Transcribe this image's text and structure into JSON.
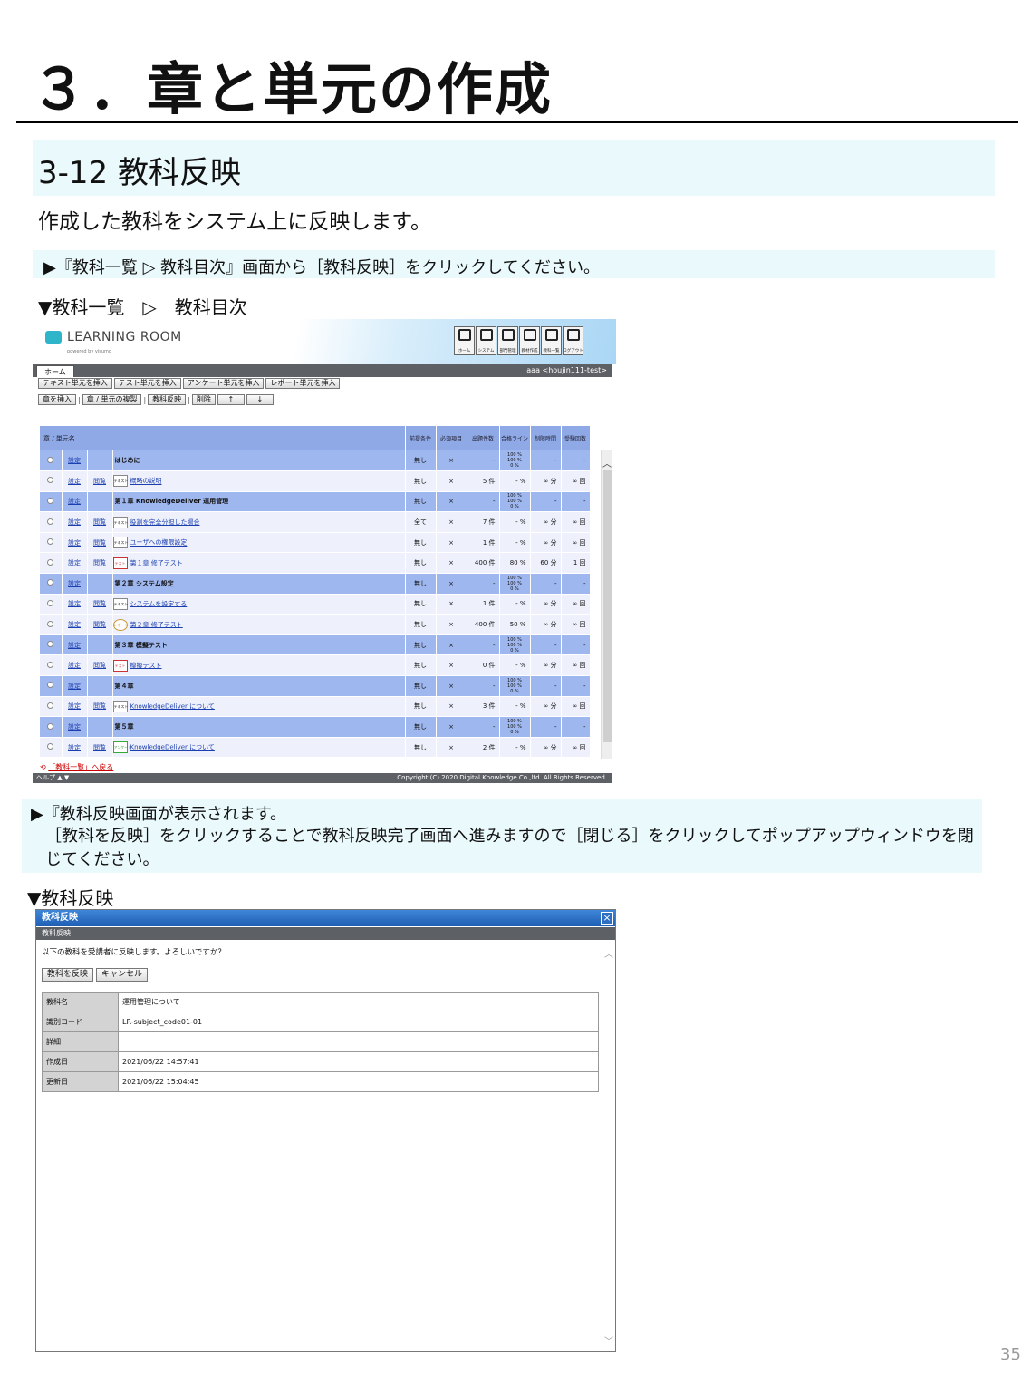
{
  "page": {
    "title": "３．章と単元の作成",
    "section_title": "3-12  教科反映",
    "intro": "作成した教科をシステム上に反映します。",
    "step1": "▶『教科一覧 ▷ 教科目次』画面から［教科反映］をクリックしてください。",
    "caption1": "▼教科一覧　▷　教科目次",
    "step2_line1": "▶『教科反映画面が表示されます。",
    "step2_line2": "［教科を反映］をクリックすることで教科反映完了画面へ進みますので［閉じる］をクリックしてポップアップウィンドウを閉じてください。",
    "caption2": "▼教科反映",
    "page_number": "35"
  },
  "shot1": {
    "logo_text": "LEARNING ROOM",
    "logo_sub": "powered by visumo",
    "toolbar": [
      {
        "label": "ホーム",
        "icon": "home-icon"
      },
      {
        "label": "システム",
        "icon": "system-icon"
      },
      {
        "label": "部門管理",
        "icon": "department-icon"
      },
      {
        "label": "教材作成",
        "icon": "material-icon"
      },
      {
        "label": "教科一覧",
        "icon": "subject-list-icon"
      },
      {
        "label": "ログアウト",
        "icon": "logout-icon"
      }
    ],
    "home_tab": "ホーム",
    "user": "aaa <houjin111-test>",
    "row1_buttons": [
      "テキスト単元を挿入",
      "テスト単元を挿入",
      "アンケート単元を挿入",
      "レポート単元を挿入"
    ],
    "row2_buttons": [
      "章を挿入",
      "章 / 単元の複製",
      "教科反映",
      "削除",
      "↑",
      "↓"
    ],
    "headers": {
      "name": "章 / 単元名",
      "h1": "前提条件",
      "h2": "必須項目",
      "h3": "出題件数",
      "h4": "合格ライン",
      "h5": "制限時間",
      "h6": "受験回数"
    },
    "setting_label": "設定",
    "view_label": "閲覧",
    "rows": [
      {
        "kind": "chap",
        "name": "はじめに",
        "c1": "無し",
        "c2": "×",
        "c3": "-",
        "c4": "100 %|100 %|0 %",
        "c5": "-",
        "c6": "-"
      },
      {
        "kind": "unit",
        "icon": "テキスト",
        "name": "概略の説明",
        "c1": "無し",
        "c2": "×",
        "c3": "5 件",
        "c4": "- %",
        "c5": "∞ 分",
        "c6": "∞ 回"
      },
      {
        "kind": "chap",
        "name": "第１章 KnowledgeDeliver 運用管理",
        "c1": "無し",
        "c2": "×",
        "c3": "-",
        "c4": "100 %|100 %|0 %",
        "c5": "-",
        "c6": "-"
      },
      {
        "kind": "unit",
        "icon": "テキスト",
        "name": "役割を完全分担した場合",
        "c1": "全て",
        "c2": "×",
        "c3": "7 件",
        "c4": "- %",
        "c5": "∞ 分",
        "c6": "∞ 回"
      },
      {
        "kind": "unit",
        "icon": "テキスト",
        "name": "ユーザへの権限設定",
        "c1": "無し",
        "c2": "×",
        "c3": "1 件",
        "c4": "- %",
        "c5": "∞ 分",
        "c6": "∞ 回"
      },
      {
        "kind": "unit",
        "icon": "テスト",
        "name": "第１章 修了テスト",
        "c1": "無し",
        "c2": "×",
        "c3": "400 件",
        "c4": "80 %",
        "c5": "60 分",
        "c6": "1 回"
      },
      {
        "kind": "chap",
        "name": "第２章 システム設定",
        "c1": "無し",
        "c2": "×",
        "c3": "-",
        "c4": "100 %|100 %|0 %",
        "c5": "-",
        "c6": "-"
      },
      {
        "kind": "unit",
        "icon": "テキスト",
        "name": "システムを設定する",
        "c1": "無し",
        "c2": "×",
        "c3": "1 件",
        "c4": "- %",
        "c5": "∞ 分",
        "c6": "∞ 回"
      },
      {
        "kind": "unit",
        "icon": "レポート",
        "name": "第２章 修了テスト",
        "c1": "無し",
        "c2": "×",
        "c3": "400 件",
        "c4": "50 %",
        "c5": "∞ 分",
        "c6": "∞ 回"
      },
      {
        "kind": "chap",
        "name": "第３章 模擬テスト",
        "c1": "無し",
        "c2": "×",
        "c3": "-",
        "c4": "100 %|100 %|0 %",
        "c5": "-",
        "c6": "-"
      },
      {
        "kind": "unit",
        "icon": "テスト",
        "name": "模擬テスト",
        "c1": "無し",
        "c2": "×",
        "c3": "0 件",
        "c4": "- %",
        "c5": "∞ 分",
        "c6": "∞ 回"
      },
      {
        "kind": "chap",
        "name": "第４章",
        "c1": "無し",
        "c2": "×",
        "c3": "-",
        "c4": "100 %|100 %|0 %",
        "c5": "-",
        "c6": "-"
      },
      {
        "kind": "unit",
        "icon": "テキスト",
        "name": "KnowledgeDeliver について",
        "c1": "無し",
        "c2": "×",
        "c3": "3 件",
        "c4": "- %",
        "c5": "∞ 分",
        "c6": "∞ 回"
      },
      {
        "kind": "chap",
        "name": "第５章",
        "c1": "無し",
        "c2": "×",
        "c3": "-",
        "c4": "100 %|100 %|0 %",
        "c5": "-",
        "c6": "-"
      },
      {
        "kind": "unit",
        "icon": "アンケート",
        "name": "KnowledgeDeliver について",
        "c1": "無し",
        "c2": "×",
        "c3": "2 件",
        "c4": "- %",
        "c5": "∞ 分",
        "c6": "∞ 回"
      }
    ],
    "back_link": "「教科一覧」へ戻る",
    "footer_help": "ヘルプ ▲ ▼",
    "footer_copy": "Copyright (C) 2020 Digital Knowledge Co.,ltd. All Rights Reserved."
  },
  "shot2": {
    "title": "教科反映",
    "subtitle": "教科反映",
    "message": "以下の教科を受講者に反映します。よろしいですか？",
    "apply_button": "教科を反映",
    "cancel_button": "キャンセル",
    "fields": [
      {
        "label": "教科名",
        "value": "運用管理について"
      },
      {
        "label": "識別コード",
        "value": "LR-subject_code01-01"
      },
      {
        "label": "詳細",
        "value": ""
      },
      {
        "label": "作成日",
        "value": "2021/06/22 14:57:41"
      },
      {
        "label": "更新日",
        "value": "2021/06/22 15:04:45"
      }
    ]
  }
}
